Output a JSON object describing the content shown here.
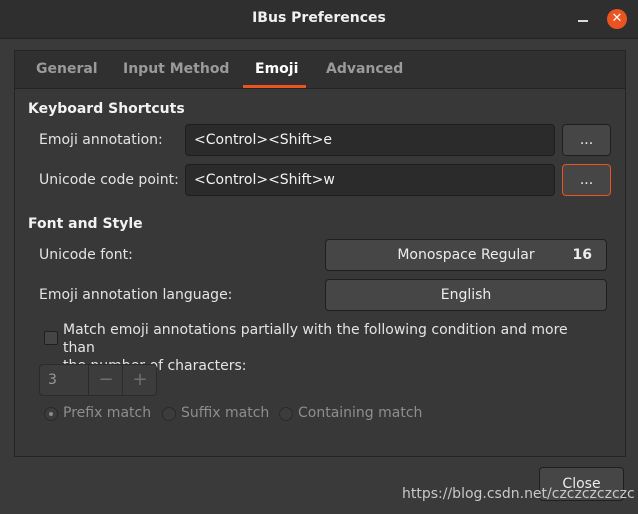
{
  "window": {
    "title": "IBus Preferences",
    "close_glyph": "✕"
  },
  "tabs": [
    {
      "label": "General"
    },
    {
      "label": "Input Method"
    },
    {
      "label": "Emoji"
    },
    {
      "label": "Advanced"
    }
  ],
  "active_tab": "Emoji",
  "keyboard_shortcuts": {
    "heading": "Keyboard Shortcuts",
    "emoji_annotation": {
      "label": "Emoji annotation:",
      "value": "<Control><Shift>e",
      "button": "..."
    },
    "unicode_code_point": {
      "label": "Unicode code point:",
      "value": "<Control><Shift>w",
      "button": "..."
    }
  },
  "font_and_style": {
    "heading": "Font and Style",
    "unicode_font": {
      "label": "Unicode font:",
      "font_name": "Monospace Regular",
      "font_size": "16"
    },
    "emoji_annotation_language": {
      "label": "Emoji annotation language:",
      "value": "English"
    },
    "partial_match": {
      "checked": false,
      "label_line1": "Match emoji annotations partially with the following condition and more than",
      "label_line2": "the number of characters:"
    },
    "characters_count": {
      "value": "3",
      "decrement": "−",
      "increment": "+"
    },
    "match_options": [
      {
        "label": "Prefix match",
        "selected": true
      },
      {
        "label": "Suffix match",
        "selected": false
      },
      {
        "label": "Containing match",
        "selected": false
      }
    ]
  },
  "footer": {
    "close_label": "Close",
    "watermark": "https://blog.csdn.net/czczczczczc"
  },
  "colors": {
    "accent": "#e95420",
    "background": "#3a3a3a"
  }
}
